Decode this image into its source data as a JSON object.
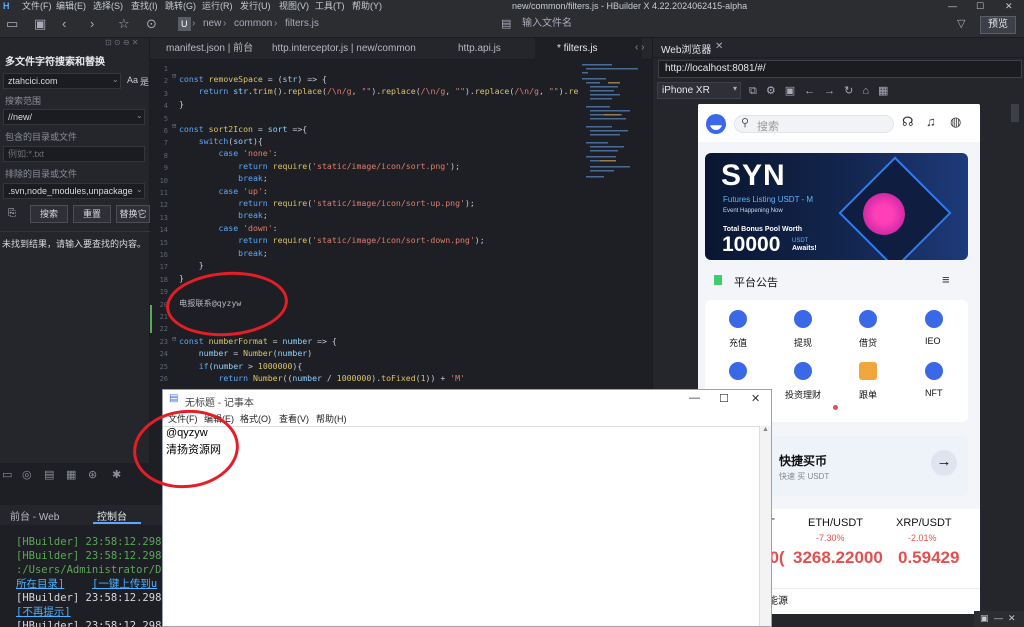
{
  "app": {
    "menu": [
      "文件(F)",
      "编辑(E)",
      "选择(S)",
      "查找(I)",
      "跳转(G)",
      "运行(R)",
      "发行(U)",
      "视图(V)",
      "工具(T)",
      "帮助(Y)"
    ],
    "title": "new/common/filters.js - HBuilder X 4.22.2024062415-alpha",
    "breadcrumb": [
      "new",
      "common",
      "filters.js"
    ],
    "file_search_placeholder": "输入文件名",
    "preview_label": "预览"
  },
  "sidebar": {
    "title": "多文件字符搜索和替换",
    "search_value": "ztahcici.com",
    "case_label": "Aa",
    "whole_word_label": "是",
    "scope_label": "搜索范围",
    "scope_value": "//new/",
    "include_label": "包含的目录或文件",
    "include_placeholder": "例如:*.txt",
    "exclude_label": "排除的目录或文件",
    "exclude_value": ".svn,node_modules,unpackage",
    "search_btn": "搜索",
    "reset_btn": "重置",
    "replace_btn": "替换它",
    "result": "未找到结果，请输入要查找的内容。"
  },
  "editor": {
    "tabs": [
      "manifest.json | 前台",
      "http.interceptor.js | new/common",
      "http.api.js",
      "* filters.js"
    ],
    "lines": [
      "1",
      "2",
      "3",
      "4",
      "5",
      "6",
      "7",
      "8",
      "9",
      "10",
      "11",
      "12",
      "13",
      "14",
      "15",
      "16",
      "17",
      "18",
      "19",
      "20",
      "21",
      "22",
      "23",
      "24",
      "25",
      "26"
    ],
    "comment_text": "电报联系@qyzyw"
  },
  "console": {
    "tabs": [
      "前台 - Web",
      "控制台"
    ],
    "lines": [
      "[HBuilder] 23:58:12.298",
      "[HBuilder] 23:58:12.298",
      ":/Users/Administrator/De",
      "所在目录]",
      "[一键上传到u",
      "[HBuilder] 23:58:12.298",
      "[不再提示]",
      "[HBuilder] 23:58:12.298"
    ]
  },
  "notepad": {
    "title": "无标题 - 记事本",
    "menu": [
      "文件(F)",
      "编辑(E)",
      "格式(O)",
      "查看(V)",
      "帮助(H)"
    ],
    "lines": [
      "@qyzyw",
      "清扬资源网"
    ]
  },
  "web": {
    "tab_label": "Web浏览器",
    "url": "http://localhost:8081/#/",
    "device": "iPhone XR",
    "phone": {
      "search_placeholder": "搜索",
      "banner": {
        "title": "SYN",
        "line1": "Futures Listing USDT - M",
        "line2": "Event Happening Now",
        "line3": "Total Bonus Pool Worth",
        "amount": "10000",
        "unit": "USDT",
        "awaits": "Awaits!"
      },
      "notice_label": "平台公告",
      "grid": [
        {
          "label": "充值",
          "color": "#3a68e6"
        },
        {
          "label": "提现",
          "color": "#3a68e6"
        },
        {
          "label": "借贷",
          "color": "#3a68e6"
        },
        {
          "label": "IEO",
          "color": "#3a68e6"
        },
        {
          "label": "",
          "color": "#3a68e6"
        },
        {
          "label": "投资理财",
          "color": "#3a68e6"
        },
        {
          "label": "跟单",
          "color": "#f2a73c"
        },
        {
          "label": "NFT",
          "color": "#3a68e6"
        }
      ],
      "buy_title": "快捷买币",
      "buy_sub": "快速 买 USDT",
      "tickers": [
        {
          "pair": "T",
          "change": "",
          "price": "00("
        },
        {
          "pair": "ETH/USDT",
          "change": "-7.30%",
          "price": "3268.22000"
        },
        {
          "pair": "XRP/USDT",
          "change": "-2.01%",
          "price": "0.59429"
        }
      ],
      "section_footer": "能源"
    }
  },
  "colors": {
    "accent": "#3a68e6",
    "red": "#e41e26",
    "down": "#e2504f"
  }
}
